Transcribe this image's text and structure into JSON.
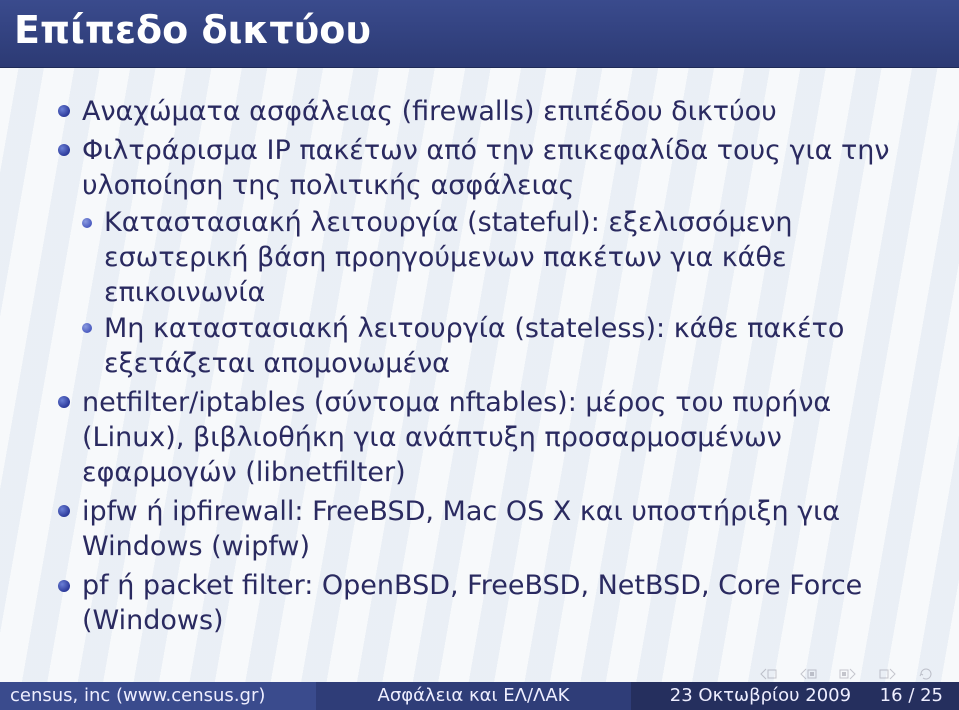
{
  "title": "Επίπεδο δικτύου",
  "bullets": [
    {
      "text": "Αναχώματα ασφάλειας (firewalls) επιπέδου δικτύου"
    },
    {
      "text": "Φιλτράρισμα IP πακέτων από την επικεφαλίδα τους για την υλοποίηση της πολιτικής ασφάλειας",
      "sub": [
        "Καταστασιακή λειτουργία (stateful): εξελισσόμενη εσωτερική βάση προηγούμενων πακέτων για κάθε επικοινωνία",
        "Μη καταστασιακή λειτουργία (stateless): κάθε πακέτο εξετάζεται απομονωμένα"
      ]
    },
    {
      "text": "netfilter/iptables (σύντομα nftables): μέρος του πυρήνα (Linux), βιβλιοθήκη για ανάπτυξη προσαρμοσμένων εφαρμογών (libnetfilter)"
    },
    {
      "text": "ipfw ή ipfirewall: FreeBSD, Mac OS X και υποστήριξη για Windows (wipfw)"
    },
    {
      "text": "pf ή packet filter: OpenBSD, FreeBSD, NetBSD, Core Force (Windows)"
    }
  ],
  "footer": {
    "left": "census, inc (www.census.gr)",
    "middle": "Ασφάλεια και ΕΛ/ΛΑΚ",
    "right_date": "23 Οκτωβρίου 2009",
    "page_current": "16",
    "page_total": "25"
  },
  "nav": {
    "prev_slide": "prev-slide",
    "next_slide": "next-slide",
    "prev_section": "prev-section",
    "next_section": "next-section",
    "home": "home"
  }
}
